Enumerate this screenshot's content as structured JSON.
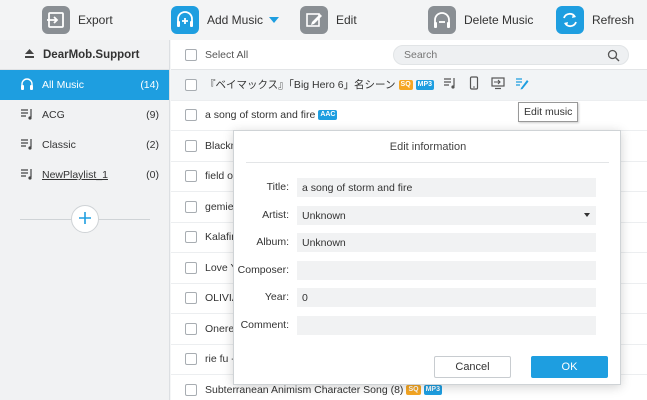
{
  "toolbar": {
    "export_label": "Export",
    "add_music_label": "Add Music",
    "edit_label": "Edit",
    "delete_music_label": "Delete Music",
    "refresh_label": "Refresh"
  },
  "sidebar": {
    "device_name": "DearMob.Support",
    "items": [
      {
        "label": "All Music",
        "count": "(14)"
      },
      {
        "label": "ACG",
        "count": "(9)"
      },
      {
        "label": "Classic",
        "count": "(2)"
      },
      {
        "label": "NewPlaylist_1",
        "count": "(0)"
      }
    ]
  },
  "list": {
    "select_all_label": "Select All",
    "search_placeholder": "Search",
    "tooltip": "Edit music",
    "rows": [
      {
        "title": "『ベイマックス』「Big Hero 6」名シーン",
        "quality": "SQ",
        "format": "MP3"
      },
      {
        "title": "a song of storm and fire",
        "quality": "",
        "format": "AAC"
      },
      {
        "title": "Blackm"
      },
      {
        "title": "field of"
      },
      {
        "title": "gemie -"
      },
      {
        "title": "Kalafina"
      },
      {
        "title": "Love Yo"
      },
      {
        "title": "OLIVIA"
      },
      {
        "title": "Onerep"
      },
      {
        "title": "rie fu -"
      },
      {
        "title": "Subterranean Animism Character Song (8)",
        "quality": "SQ",
        "format": "MP3"
      }
    ]
  },
  "dialog": {
    "title": "Edit information",
    "fields": {
      "title_label": "Title:",
      "title_value": "a song of storm and fire",
      "artist_label": "Artist:",
      "artist_value": "Unknown",
      "album_label": "Album:",
      "album_value": "Unknown",
      "composer_label": "Composer:",
      "composer_value": "",
      "year_label": "Year:",
      "year_value": "0",
      "comment_label": "Comment:",
      "comment_value": ""
    },
    "cancel_label": "Cancel",
    "ok_label": "OK"
  },
  "colors": {
    "accent": "#1e9ee0",
    "quality_badge": "#f5a623",
    "icon_gray": "#8a8f94"
  },
  "icons": {
    "export": "export-icon",
    "add_music": "add-music-icon",
    "edit": "edit-icon",
    "delete": "delete-icon",
    "refresh": "refresh-icon",
    "device": "eject-icon",
    "all_music": "headphones-icon",
    "playlist": "playlist-icon",
    "add_playlist": "plus-icon",
    "search": "search-icon"
  }
}
